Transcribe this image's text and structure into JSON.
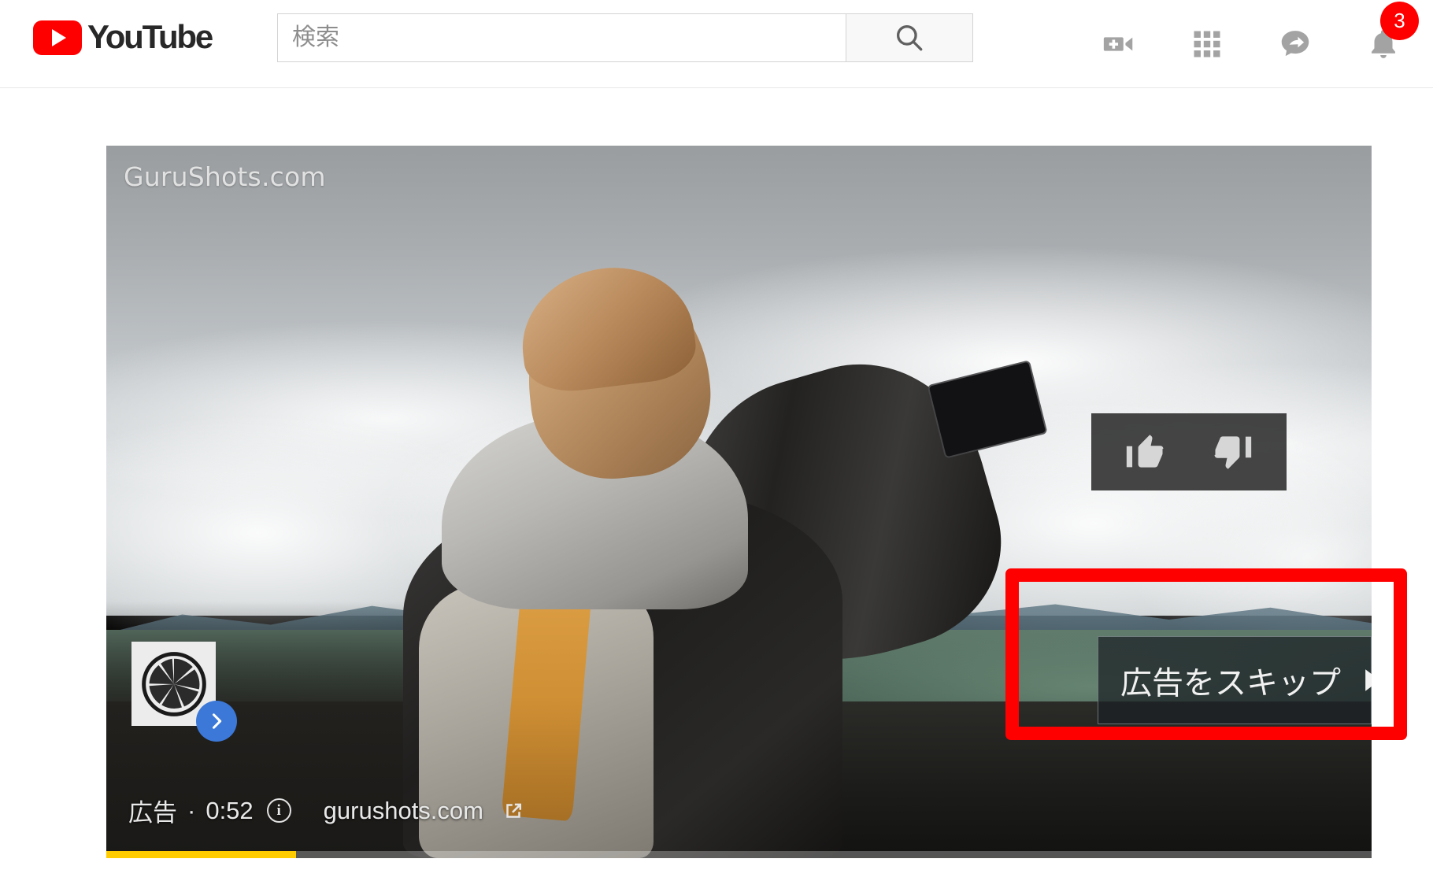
{
  "header": {
    "brand": "YouTube",
    "brand_icon": "youtube-play-logo",
    "search": {
      "placeholder": "検索",
      "value": "",
      "button_icon": "search-icon"
    },
    "icons": [
      {
        "name": "create-video-icon",
        "label": "動画または投稿を作成"
      },
      {
        "name": "apps-grid-icon",
        "label": "YouTube アプリ"
      },
      {
        "name": "messages-icon",
        "label": "メッセージ"
      },
      {
        "name": "notifications-bell-icon",
        "label": "通知"
      }
    ],
    "notification_count": "3",
    "notification_badge_color": "#ff0000"
  },
  "player": {
    "watermark": "GuruShots.com",
    "rating": {
      "like_icon": "thumbs-up-icon",
      "dislike_icon": "thumbs-down-icon"
    },
    "ad_info": {
      "ad_label": "広告",
      "separator": "·",
      "time_remaining": "0:52",
      "info_glyph": "i",
      "advertiser_domain": "gurushots.com",
      "external_link_icon": "external-link-icon"
    },
    "ad_card": {
      "logo_icon": "camera-aperture-icon",
      "expand_icon": "chevron-right-icon"
    },
    "skip_button": {
      "label": "広告をスキップ",
      "icon": "skip-next-icon"
    },
    "progress": {
      "percent": 15,
      "fill_color": "#ffcc00"
    }
  },
  "annotation": {
    "name": "skip-ad-highlight",
    "color": "#ff0000"
  }
}
